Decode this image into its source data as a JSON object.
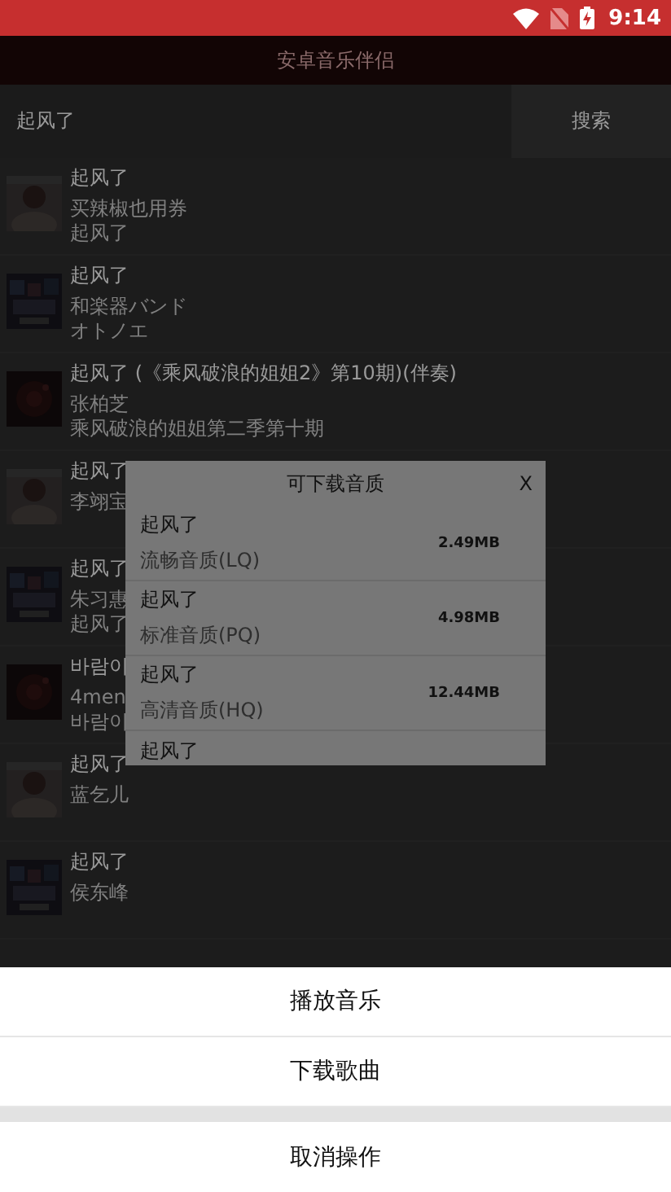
{
  "status_bar": {
    "time": "9:14"
  },
  "app_bar": {
    "title": "安卓音乐伴侣"
  },
  "search": {
    "value": "起风了",
    "button": "搜索"
  },
  "songs": [
    {
      "title": "起风了",
      "lines": [
        "买辣椒也用券",
        "起风了"
      ]
    },
    {
      "title": "起风了",
      "lines": [
        "和楽器バンド",
        "オトノエ"
      ]
    },
    {
      "title": "起风了 (《乘风破浪的姐姐2》第10期)(伴奏)",
      "lines": [
        "张柏芝",
        "乘风破浪的姐姐第二季第十期"
      ]
    },
    {
      "title": "起风了",
      "lines": [
        "李翊宝"
      ]
    },
    {
      "title": "起风了",
      "lines": [
        "朱习惠",
        "起风了"
      ]
    },
    {
      "title": "바람이",
      "lines": [
        "4men",
        "바람이"
      ]
    },
    {
      "title": "起风了",
      "lines": [
        "蓝乞儿"
      ]
    },
    {
      "title": "起风了",
      "lines": [
        "侯东峰"
      ]
    }
  ],
  "quality_dialog": {
    "title": "可下载音质",
    "close": "X",
    "options": [
      {
        "name": "起风了",
        "quality": "流畅音质(LQ)",
        "size": "2.49MB"
      },
      {
        "name": "起风了",
        "quality": "标准音质(PQ)",
        "size": "4.98MB"
      },
      {
        "name": "起风了",
        "quality": "高清音质(HQ)",
        "size": "12.44MB"
      },
      {
        "name": "起风了"
      }
    ]
  },
  "action_sheet": {
    "actions": [
      "播放音乐",
      "下载歌曲"
    ],
    "cancel": "取消操作"
  }
}
